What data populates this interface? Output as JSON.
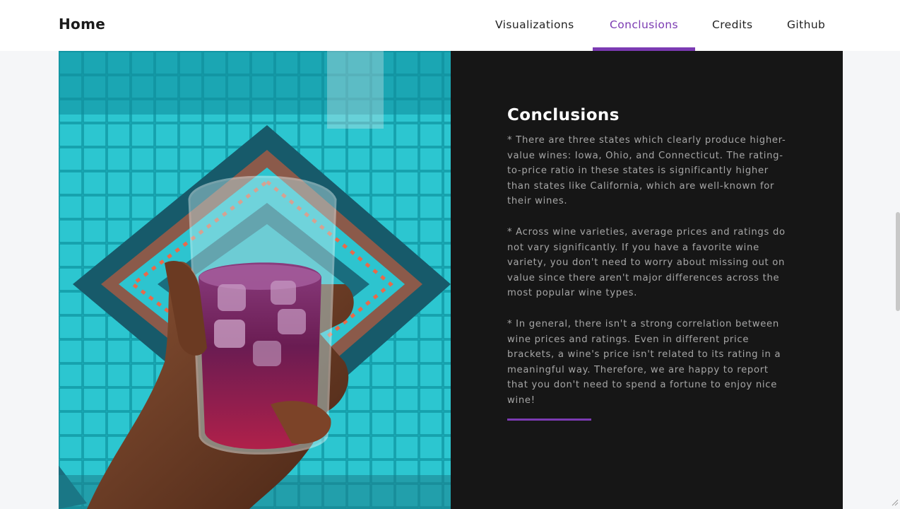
{
  "nav": {
    "brand": "Home",
    "links": [
      {
        "label": "Visualizations",
        "active": false
      },
      {
        "label": "Conclusions",
        "active": true
      },
      {
        "label": "Credits",
        "active": false
      },
      {
        "label": "Github",
        "active": false
      }
    ]
  },
  "hero_image": {
    "alt": "",
    "icon": "photo-hand-holding-drink-over-pool"
  },
  "conclusions": {
    "title": "Conclusions",
    "paragraphs": [
      "* There are three states which clearly produce higher-value wines: Iowa, Ohio, and Connecticut. The rating-to-price ratio in these states is significantly higher than states like California, which are well-known for their wines.",
      "* Across wine varieties, average prices and ratings do not vary significantly. If you have a favorite wine variety, you don't need to worry about missing out on value since there aren't major differences across the most popular wine types.",
      "* In general, there isn't a strong correlation between wine prices and ratings. Even in different price brackets, a wine's price isn't related to its rating in a meaningful way. Therefore, we are happy to report that you don't need to spend a fortune to enjoy nice wine!"
    ]
  },
  "colors": {
    "accent": "#7b3ab2",
    "panel_bg": "#161616",
    "page_bg": "#f5f6f8"
  }
}
